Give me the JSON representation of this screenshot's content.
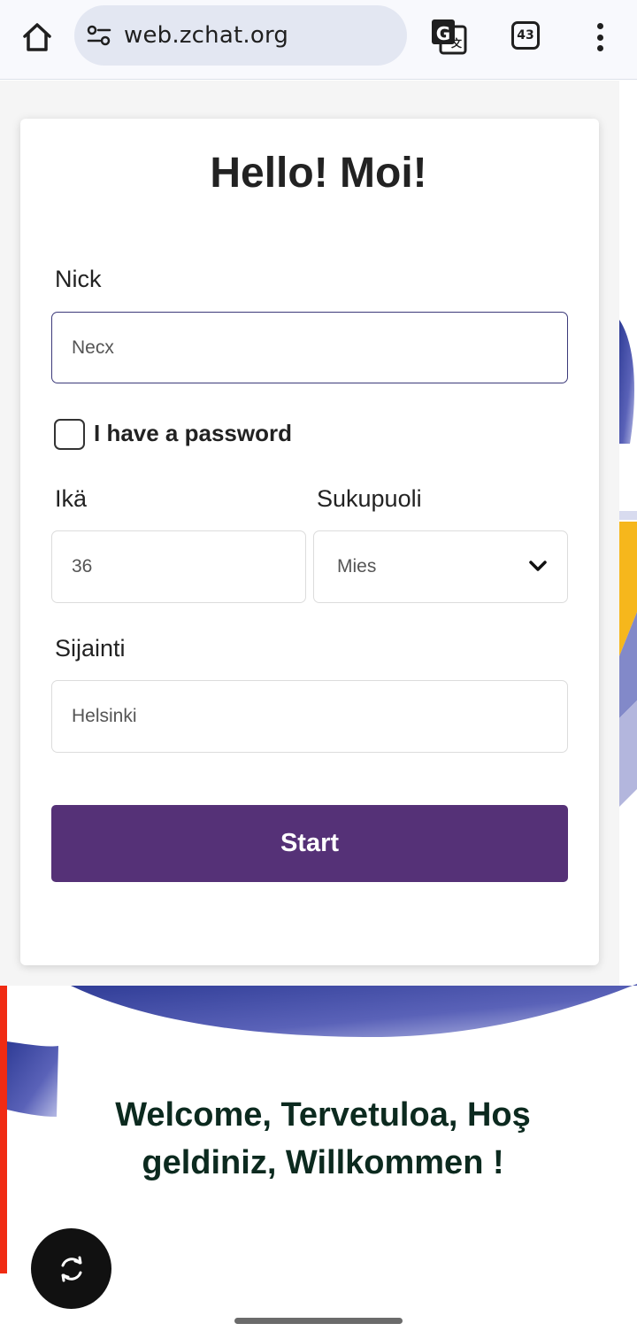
{
  "browser": {
    "url": "web.zchat.org",
    "tab_count": "43",
    "icons": [
      "home-icon",
      "site-settings-icon",
      "translate-icon",
      "tabs-icon",
      "more-menu-icon"
    ]
  },
  "form": {
    "title": "Hello! Moi!",
    "nick_label": "Nick",
    "nick_value": "Necx",
    "password_checkbox_label": "I have a password",
    "password_checked": false,
    "age_label": "Ikä",
    "age_value": "36",
    "gender_label": "Sukupuoli",
    "gender_value": "Mies",
    "location_label": "Sijainti",
    "location_value": "Helsinki",
    "start_label": "Start"
  },
  "welcome_text": "Welcome, Tervetuloa, Hoş geldiniz, Willkommen !",
  "colors": {
    "primary_button": "#553177",
    "welcome_text": "#0c2a1f",
    "accent_red": "#f02b13",
    "decor_blue": "#3b44a0",
    "decor_yellow": "#f6b71c"
  }
}
